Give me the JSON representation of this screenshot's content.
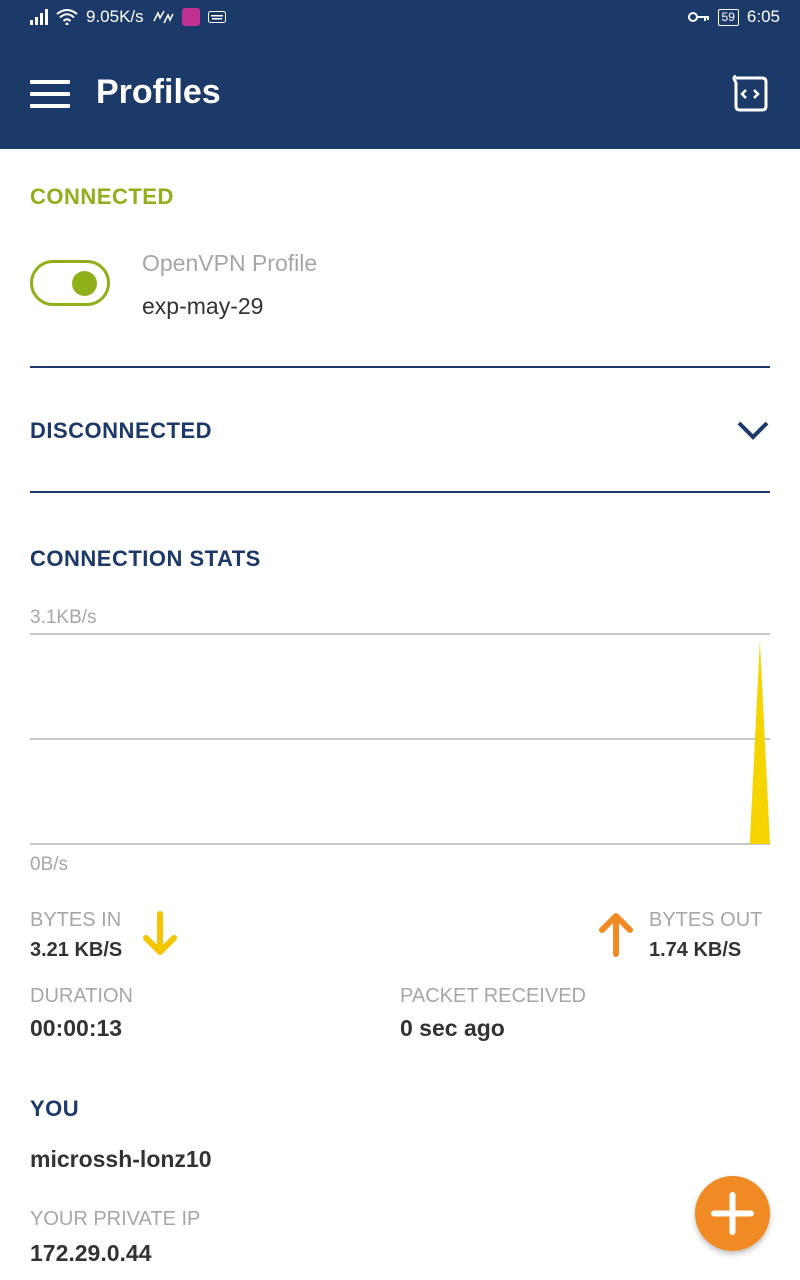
{
  "status_bar": {
    "net_speed": "9.05K/s",
    "vpn_key_icon": "key-icon",
    "battery": "59",
    "time": "6:05"
  },
  "app_bar": {
    "title": "Profiles",
    "menu_icon": "hamburger-icon",
    "action_icon": "script-code-icon"
  },
  "connected": {
    "section_label": "CONNECTED",
    "toggle_on": true,
    "profile_type": "OpenVPN Profile",
    "profile_name": "exp-may-29"
  },
  "disconnected": {
    "section_label": "DISCONNECTED",
    "icon": "chevron-down-icon"
  },
  "stats": {
    "section_label": "CONNECTION STATS",
    "bytes_in_label": "BYTES IN",
    "bytes_in_value": "3.21 KB/S",
    "bytes_out_label": "BYTES OUT",
    "bytes_out_value": "1.74 KB/S",
    "duration_label": "DURATION",
    "duration_value": "00:00:13",
    "packet_label": "PACKET RECEIVED",
    "packet_value": "0 sec ago"
  },
  "chart_data": {
    "type": "area",
    "title": "",
    "xlabel": "",
    "ylabel": "",
    "ymax_label": "3.1KB/s",
    "ymin_label": "0B/s",
    "ylim": [
      0,
      3.1
    ],
    "series": [
      {
        "values": [
          0,
          0,
          0,
          0,
          0,
          0,
          0,
          0,
          0,
          0,
          0,
          0,
          0,
          0,
          0,
          0,
          0,
          0,
          0,
          0,
          0,
          0,
          0,
          0,
          0,
          0,
          0,
          0,
          0,
          0,
          0,
          0,
          0,
          0,
          0,
          0,
          0,
          0,
          0,
          0,
          0,
          0,
          0,
          0,
          0,
          0,
          0,
          0,
          0,
          0,
          0,
          0,
          0,
          0,
          0,
          0,
          0,
          0,
          0,
          0,
          0,
          0,
          0,
          0,
          0,
          0,
          0,
          0,
          0,
          0,
          0,
          0,
          3.0,
          0
        ],
        "color": "#f5d400"
      }
    ],
    "grid": true
  },
  "you": {
    "section_label": "YOU",
    "host_name": "microssh-lonz10",
    "private_ip_label": "YOUR PRIVATE IP",
    "private_ip_value": "172.29.0.44"
  },
  "fab": {
    "icon": "plus-icon"
  },
  "colors": {
    "primary": "#1b3a69",
    "connected_green": "#8fb01b",
    "bytes_in_yellow": "#f5c400",
    "bytes_out_orange": "#f08a24",
    "fab_orange": "#f08a24"
  }
}
